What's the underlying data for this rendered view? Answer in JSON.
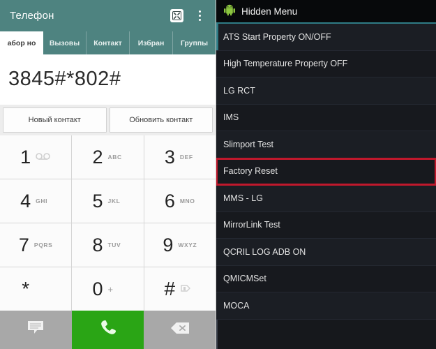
{
  "phone": {
    "appbar": {
      "title": "Телефон",
      "video_icon": "video-call-icon",
      "overflow_icon": "overflow-menu-icon"
    },
    "tabs": [
      {
        "label": "абор но",
        "active": true
      },
      {
        "label": "Вызовы",
        "active": false
      },
      {
        "label": "Контакт",
        "active": false
      },
      {
        "label": "Избран",
        "active": false
      },
      {
        "label": "Группы",
        "active": false
      }
    ],
    "dialed_number": "3845#*802#",
    "actions": {
      "new_contact": "Новый контакт",
      "update_contact": "Обновить контакт"
    },
    "keypad": [
      {
        "digit": "1",
        "sub": "",
        "icon": "voicemail-icon"
      },
      {
        "digit": "2",
        "sub": "ABC",
        "icon": ""
      },
      {
        "digit": "3",
        "sub": "DEF",
        "icon": ""
      },
      {
        "digit": "4",
        "sub": "GHI",
        "icon": ""
      },
      {
        "digit": "5",
        "sub": "JKL",
        "icon": ""
      },
      {
        "digit": "6",
        "sub": "MNO",
        "icon": ""
      },
      {
        "digit": "7",
        "sub": "PQRS",
        "icon": ""
      },
      {
        "digit": "8",
        "sub": "TUV",
        "icon": ""
      },
      {
        "digit": "9",
        "sub": "WXYZ",
        "icon": ""
      },
      {
        "digit": "*",
        "sub": "",
        "icon": ""
      },
      {
        "digit": "0",
        "sub": "+",
        "icon": ""
      },
      {
        "digit": "#",
        "sub": "",
        "icon": "pause-icon"
      }
    ],
    "bottombar": {
      "message_icon": "message-icon",
      "call_icon": "call-icon",
      "backspace_icon": "backspace-icon"
    },
    "colors": {
      "appbar": "#4e8380",
      "call_green": "#2aa515",
      "bottombar_gray": "#a8a8a8"
    }
  },
  "hidden_menu": {
    "header": {
      "title": "Hidden Menu",
      "icon": "android-robot-icon"
    },
    "items": [
      {
        "label": "ATS Start Property ON/OFF",
        "selected": false
      },
      {
        "label": "High Temperature Property OFF",
        "selected": false
      },
      {
        "label": "LG RCT",
        "selected": false
      },
      {
        "label": "IMS",
        "selected": false
      },
      {
        "label": "Slimport Test",
        "selected": false
      },
      {
        "label": "Factory Reset",
        "selected": true
      },
      {
        "label": "MMS - LG",
        "selected": false
      },
      {
        "label": "MirrorLink Test",
        "selected": false
      },
      {
        "label": "QCRIL LOG ADB ON",
        "selected": false
      },
      {
        "label": "QMICMSet",
        "selected": false
      },
      {
        "label": "MOCA",
        "selected": false
      }
    ],
    "colors": {
      "background": "#16181c",
      "header_bg": "#07090b",
      "accent": "#2f7c86",
      "highlight_border": "#c0182c"
    }
  }
}
